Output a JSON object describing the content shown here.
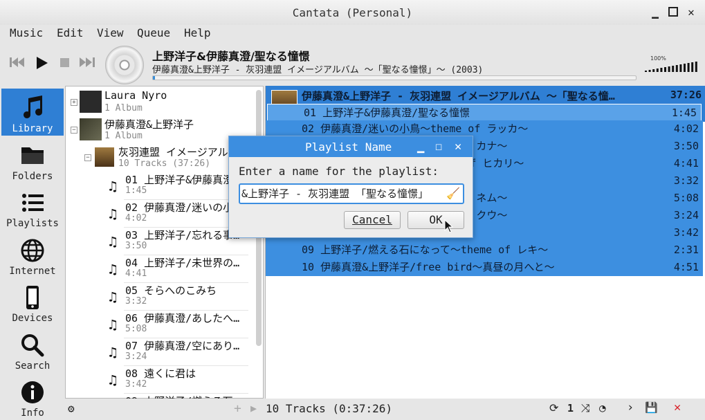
{
  "window": {
    "title": "Cantata (Personal)"
  },
  "menu": [
    "Music",
    "Edit",
    "View",
    "Queue",
    "Help"
  ],
  "now_playing": {
    "title": "上野洋子&伊藤真澄/聖なる憧憬",
    "subtitle": "伊藤真澄&上野洋子 - 灰羽連盟 イメージアルバム 〜「聖なる憧憬」〜 (2003)",
    "progress": 0.001
  },
  "volume": {
    "label": "100%",
    "level": 1.0
  },
  "sidebar": [
    {
      "label": "Library",
      "icon": "music-note-icon"
    },
    {
      "label": "Folders",
      "icon": "folder-icon"
    },
    {
      "label": "Playlists",
      "icon": "list-icon"
    },
    {
      "label": "Internet",
      "icon": "globe-icon"
    },
    {
      "label": "Devices",
      "icon": "phone-icon"
    },
    {
      "label": "Search",
      "icon": "search-icon"
    },
    {
      "label": "Info",
      "icon": "info-icon"
    }
  ],
  "library": {
    "artists": [
      {
        "name": "Laura Nyro",
        "sub": "1 Album",
        "expander": "+"
      },
      {
        "name": "伊藤真澄&上野洋子",
        "sub": "1 Album",
        "expander": "−"
      }
    ],
    "album": {
      "name": "灰羽連盟 イメージアルバム",
      "sub": "10 Tracks (37:26)",
      "expander": "−"
    },
    "tracks": [
      {
        "title": "01 上野洋子&伊藤真澄/聖なる憧憬",
        "dur": "1:45"
      },
      {
        "title": "02 伊藤真澄/迷いの小鳥〜theme of ラッカ〜",
        "dur": "4:02"
      },
      {
        "title": "03 上野洋子/忘れる事…",
        "dur": "3:50"
      },
      {
        "title": "04 上野洋子/未世界の…",
        "dur": "4:41"
      },
      {
        "title": "05 そらへのこみち",
        "dur": "3:32"
      },
      {
        "title": "06 伊藤真澄/あしたへ…",
        "dur": "5:08"
      },
      {
        "title": "07 伊藤真澄/空にあり…",
        "dur": "3:24"
      },
      {
        "title": "08 遠くに君は",
        "dur": "3:42"
      },
      {
        "title": "09 上野洋子/燃える石…",
        "dur": ""
      }
    ]
  },
  "playqueue": {
    "header": "伊藤真澄&上野洋子 - 灰羽連盟 イメージアルバム 〜「聖なる憧…",
    "header_dur": "37:26",
    "rows": [
      {
        "n": "01 上野洋子&伊藤真澄/聖なる憧憬",
        "d": "1:45"
      },
      {
        "n": "02 伊藤真澄/迷いの小鳥〜theme of ラッカ〜",
        "d": "4:02"
      },
      {
        "n": "03 上野洋子/忘れる事〜theme of カナ〜",
        "d": "3:50"
      },
      {
        "n": "04 上野洋子/未世界の…〜theme of ヒカリ〜",
        "d": "4:41"
      },
      {
        "n": "05 そらへのこみち",
        "d": "3:32"
      },
      {
        "n": "06 伊藤真澄/あしたへ〜theme of ネム〜",
        "d": "5:08"
      },
      {
        "n": "07 伊藤真澄/空にあり〜theme of クウ〜",
        "d": "3:24"
      },
      {
        "n": "08 遠くに君は",
        "d": "3:42"
      },
      {
        "n": "09 上野洋子/燃える石になって〜theme of レキ〜",
        "d": "2:31"
      },
      {
        "n": "10 伊藤真澄&上野洋子/free bird〜真昼の月へと〜",
        "d": "4:51"
      }
    ]
  },
  "status": {
    "tracks": "10 Tracks (0:37:26)",
    "repeat_count": "1"
  },
  "dialog": {
    "title": "Playlist Name",
    "label": "Enter a name for the playlist:",
    "value": "&上野洋子 - 灰羽連盟 「聖なる憧憬」",
    "cancel": "Cancel",
    "ok": "OK"
  },
  "colors": {
    "accent": "#2f7fd4",
    "selection": "#3d8fe0",
    "close_red": "#d9232a"
  }
}
